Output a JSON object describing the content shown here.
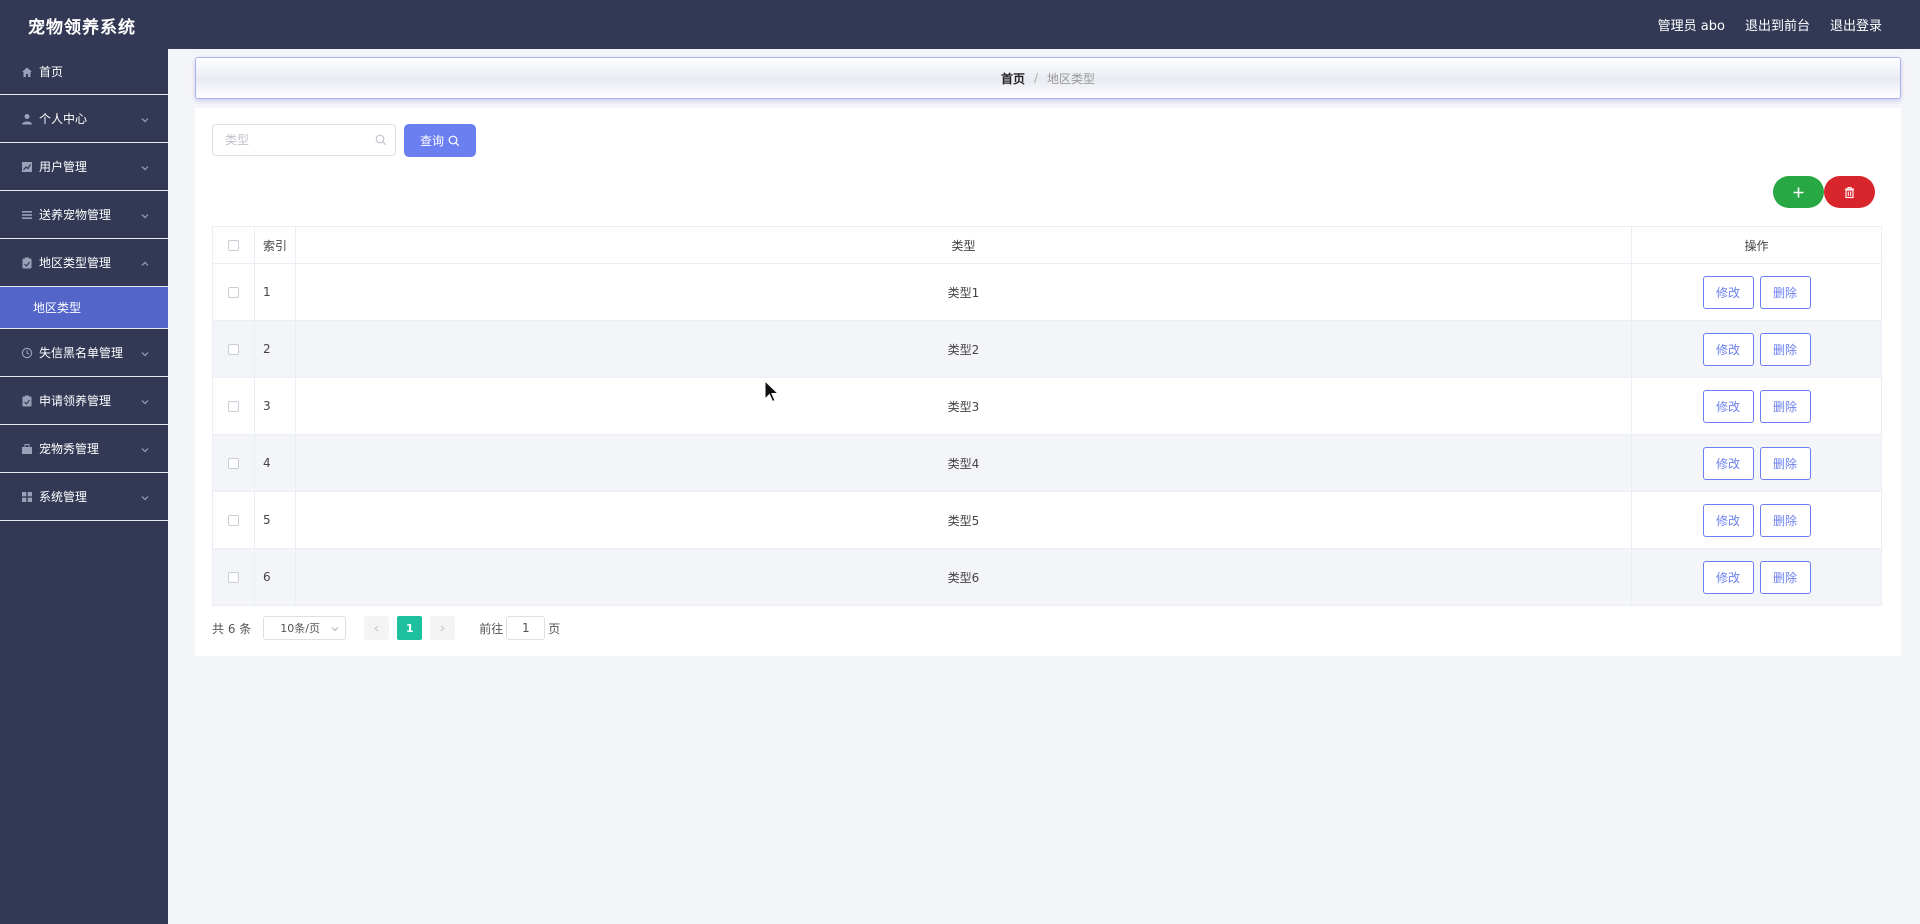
{
  "app": {
    "title": "宠物领养系统"
  },
  "header": {
    "user_label": "管理员 abo",
    "to_front_label": "退出到前台",
    "logout_label": "退出登录"
  },
  "sidebar": {
    "items": [
      {
        "label": "首页",
        "icon": "home-icon"
      },
      {
        "label": "个人中心",
        "icon": "user-icon"
      },
      {
        "label": "用户管理",
        "icon": "chart-icon"
      },
      {
        "label": "送养宠物管理",
        "icon": "list-icon"
      },
      {
        "label": "地区类型管理",
        "icon": "clipboard-icon",
        "expanded": true,
        "sub": [
          "地区类型"
        ]
      },
      {
        "label": "失信黑名单管理",
        "icon": "clock-icon"
      },
      {
        "label": "申请领养管理",
        "icon": "clipboard-icon"
      },
      {
        "label": "宠物秀管理",
        "icon": "briefcase-icon"
      },
      {
        "label": "系统管理",
        "icon": "grid-icon"
      }
    ]
  },
  "breadcrumb": {
    "home": "首页",
    "separator": "/",
    "current": "地区类型"
  },
  "search": {
    "placeholder": "类型",
    "value": "",
    "query_label": "查询"
  },
  "toolbar": {
    "add_icon": "plus-icon",
    "delete_icon": "trash-icon",
    "add_color": "#27a844",
    "delete_color": "#d9262c"
  },
  "table": {
    "columns": [
      "索引",
      "类型",
      "操作"
    ],
    "rows": [
      {
        "index": "1",
        "type": "类型1"
      },
      {
        "index": "2",
        "type": "类型2"
      },
      {
        "index": "3",
        "type": "类型3"
      },
      {
        "index": "4",
        "type": "类型4"
      },
      {
        "index": "5",
        "type": "类型5"
      },
      {
        "index": "6",
        "type": "类型6"
      }
    ],
    "edit_label": "修改",
    "delete_label": "删除"
  },
  "pagination": {
    "total_text": "共 6 条",
    "page_size": "10条/页",
    "current_page": "1",
    "goto_prefix": "前往",
    "goto_value": "1",
    "goto_suffix": "页"
  },
  "colors": {
    "sidebar_bg": "#333854",
    "accent": "#6b7ff0",
    "active_sub": "#5465c9",
    "pager_active": "#1fc0a0"
  }
}
